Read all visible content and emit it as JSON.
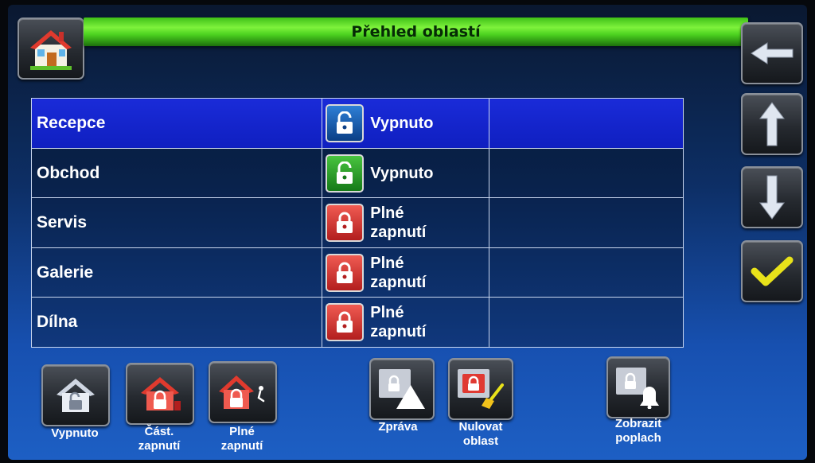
{
  "title": "Přehled oblastí",
  "colors": {
    "title_bar": "#4bd11f",
    "selected_row": "#1a2bd8",
    "lock_open_blue": "#2e7fd6",
    "lock_open_green": "#49c43f",
    "lock_armed_red": "#e03a33",
    "check": "#e8e21a"
  },
  "header": {
    "home_icon": "house-icon",
    "back_icon": "arrow-left-icon"
  },
  "side_nav": {
    "up_icon": "arrow-up-icon",
    "down_icon": "arrow-down-icon",
    "confirm_icon": "checkmark-icon"
  },
  "areas": [
    {
      "name": "Recepce",
      "state_line1": "Vypnuto",
      "state_line2": "",
      "lock": "unlocked-blue-icon",
      "selected": true
    },
    {
      "name": "Obchod",
      "state_line1": "Vypnuto",
      "state_line2": "",
      "lock": "unlocked-green-icon",
      "selected": false
    },
    {
      "name": "Servis",
      "state_line1": "Plné",
      "state_line2": "zapnutí",
      "lock": "locked-red-icon",
      "selected": false
    },
    {
      "name": "Galerie",
      "state_line1": "Plné",
      "state_line2": "zapnutí",
      "lock": "locked-red-icon",
      "selected": false
    },
    {
      "name": "Dílna",
      "state_line1": "Plné",
      "state_line2": "zapnutí",
      "lock": "locked-red-icon",
      "selected": false
    }
  ],
  "bottom_buttons": {
    "off": {
      "label": "Vypnuto",
      "icon": "house-unlocked-icon"
    },
    "partial": {
      "line1": "Část.",
      "line2": "zapnutí",
      "icon": "house-partial-lock-icon"
    },
    "full": {
      "line1": "Plné",
      "line2": "zapnutí",
      "icon": "house-lock-exit-icon"
    },
    "report": {
      "label": "Zpráva",
      "icon": "report-warning-icon"
    },
    "reset": {
      "line1": "Nulovat",
      "line2": "oblast",
      "icon": "reset-brush-icon"
    },
    "alarm": {
      "line1": "Zobrazit",
      "line2": "poplach",
      "icon": "alarm-bell-icon"
    }
  }
}
